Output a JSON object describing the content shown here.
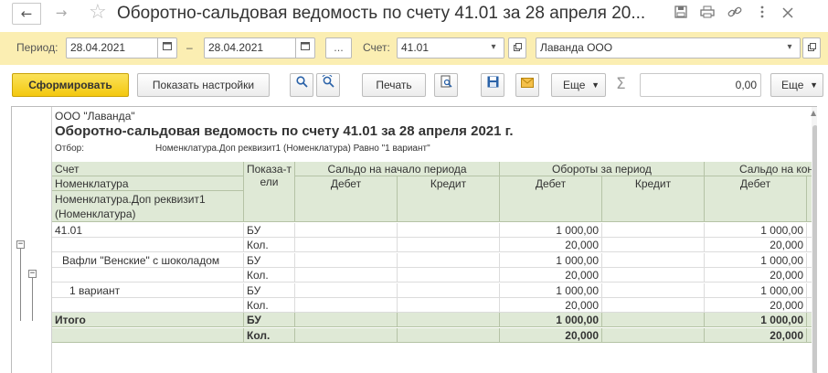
{
  "window": {
    "title": "Оборотно-сальдовая ведомость по счету 41.01 за 28 апреля 20...",
    "back_glyph": "←",
    "forward_glyph": "→",
    "favorite_glyph": "☆",
    "titlebar_icons": [
      "save-icon",
      "print-icon",
      "link-icon",
      "more-icon",
      "close-icon"
    ]
  },
  "filters": {
    "period_label": "Период:",
    "date_from": "28.04.2021",
    "dash": "–",
    "date_to": "28.04.2021",
    "ellipsis": "...",
    "account_label": "Счет:",
    "account_value": "41.01",
    "org_value": "Лаванда ООО"
  },
  "toolbar": {
    "generate_label": "Сформировать",
    "settings_label": "Показать настройки",
    "print_label": "Печать",
    "more_label": "Еще",
    "more2_label": "Еще",
    "sum_value": "0,00",
    "sum_symbol": "Σ"
  },
  "report": {
    "organization": "ООО \"Лаванда\"",
    "title": "Оборотно-сальдовая ведомость по счету 41.01 за 28 апреля 2021 г.",
    "filter_label": "Отбор:",
    "filter_value": "Номенклатура.Доп реквизит1  (Номенклатура) Равно \"1 вариант\"",
    "header": {
      "col_account": "Счет",
      "col_nomenclature": "Номенклатура",
      "col_attr": "Номенклатура.Доп реквизит1 (Номенклатура)",
      "col_indicators": "Показа-тели",
      "group_opening": "Сальдо на начало периода",
      "group_turnover": "Обороты за период",
      "group_closing": "Сальдо на кон",
      "debit": "Дебет",
      "credit": "Кредит"
    },
    "rows": [
      {
        "label": "41.01",
        "ind": "БУ",
        "turn_debit": "1 000,00",
        "close_debit": "1 000,00"
      },
      {
        "label": "",
        "ind": "Кол.",
        "turn_debit": "20,000",
        "close_debit": "20,000"
      },
      {
        "label": "Вафли \"Венские\" с шоколадом",
        "ind": "БУ",
        "turn_debit": "1 000,00",
        "close_debit": "1 000,00"
      },
      {
        "label": "",
        "ind": "Кол.",
        "turn_debit": "20,000",
        "close_debit": "20,000"
      },
      {
        "label": "1 вариант",
        "ind": "БУ",
        "turn_debit": "1 000,00",
        "close_debit": "1 000,00"
      },
      {
        "label": "",
        "ind": "Кол.",
        "turn_debit": "20,000",
        "close_debit": "20,000"
      },
      {
        "label": "Итого",
        "ind": "БУ",
        "turn_debit": "1 000,00",
        "close_debit": "1 000,00"
      },
      {
        "label": "",
        "ind": "Кол.",
        "turn_debit": "20,000",
        "close_debit": "20,000"
      }
    ]
  },
  "colors": {
    "filter_bar": "#fbeeb2",
    "primary_button": "#f3c80f",
    "header_fill": "#dfe9d6"
  }
}
